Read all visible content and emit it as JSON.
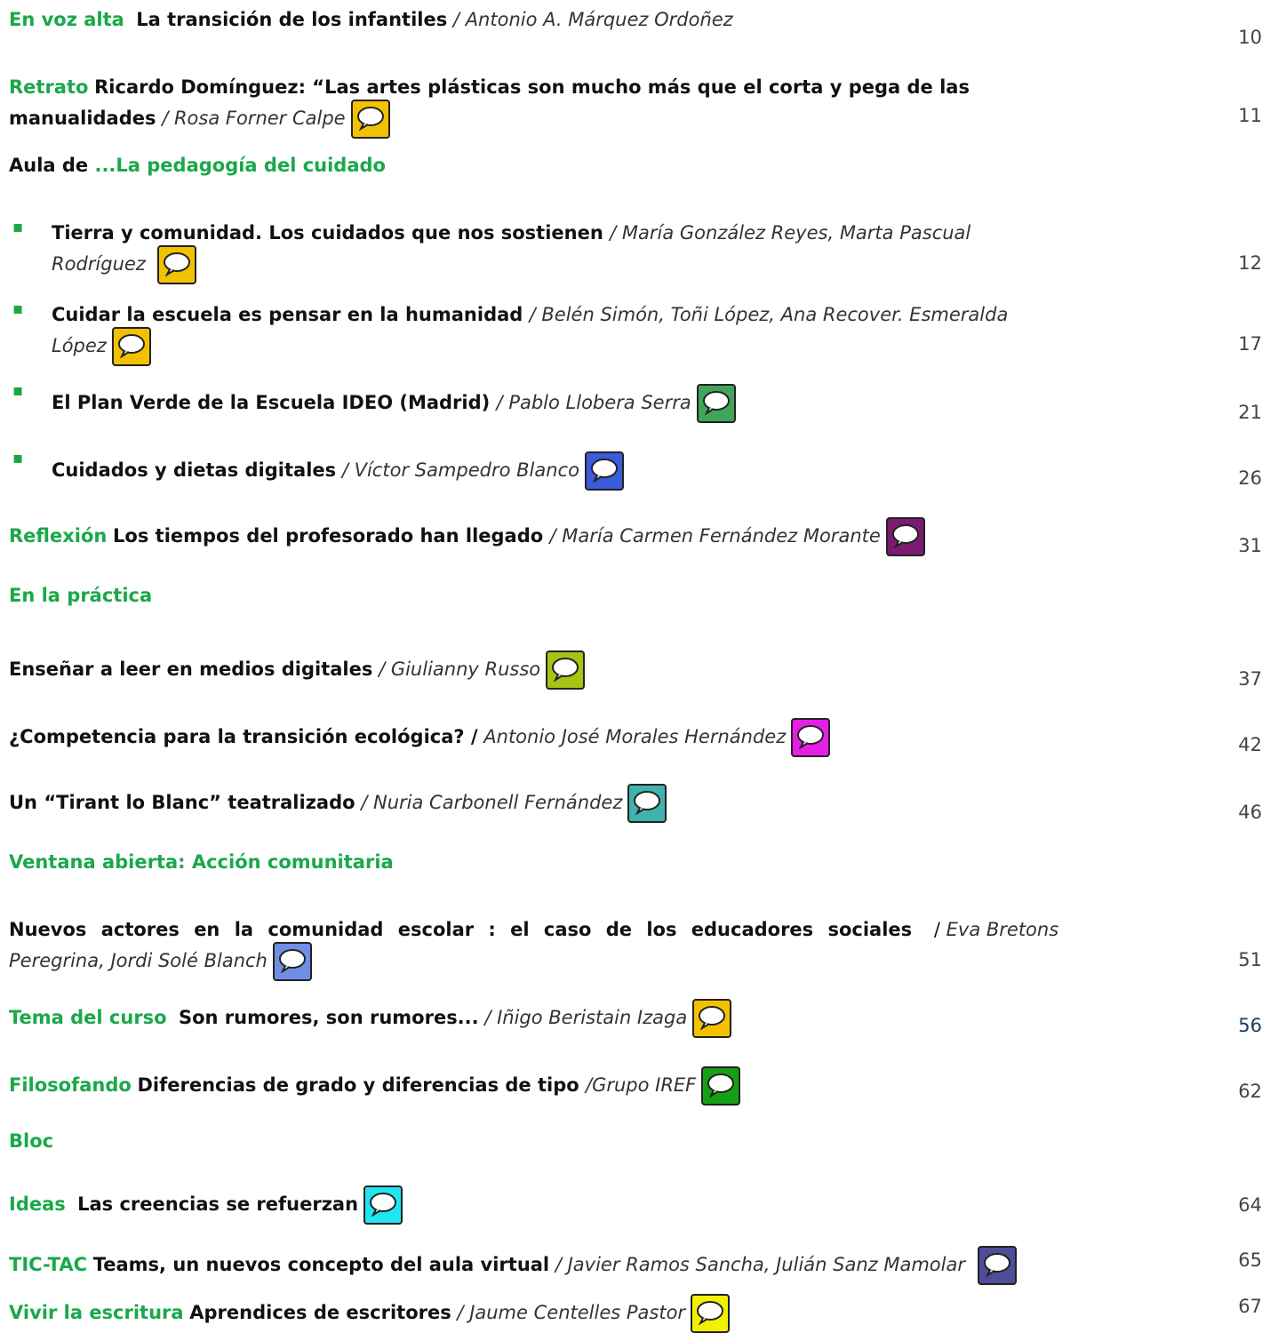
{
  "entries": [
    {
      "id": "e1",
      "section": "En voz alta",
      "title": "La transición de los infantiles",
      "author": "Antonio A. Márquez Ordoñez",
      "page": "10"
    },
    {
      "id": "e2",
      "section": "Retrato",
      "title_line1": "Ricardo Domínguez: “Las artes plásticas son mucho más  que el corta y pega de las",
      "title_line2": "manualidades",
      "author": "Rosa Forner Calpe",
      "page": "11",
      "icon": "#f2c200"
    },
    {
      "id": "e3",
      "section_a": "Aula de ",
      "section_b": "...La pedagogía del cuidado"
    },
    {
      "id": "e4",
      "title": "Tierra y comunidad. Los cuidados que nos sostienen ",
      "author_l1": "María González Reyes, Marta Pascual",
      "author_l2": "Rodríguez ",
      "page": "12",
      "icon": "#f2c200"
    },
    {
      "id": "e5",
      "title": "Cuidar la escuela es pensar en la humanidad ",
      "author_l1": "Belén Simón, Toñi López, Ana Recover. Esmeralda",
      "author_l2": "López",
      "page": "17",
      "icon": "#f2c200"
    },
    {
      "id": "e6",
      "title": "El Plan Verde de la Escuela IDEO (Madrid) ",
      "author": "Pablo Llobera Serra",
      "page": "21",
      "icon": "#3fa55a"
    },
    {
      "id": "e7",
      "title": "Cuidados y dietas digitales",
      "author": "Víctor Sampedro Blanco",
      "page": "26",
      "icon": "#3b5bdb"
    },
    {
      "id": "e8",
      "section": "Reflexión",
      "title": "Los tiempos del profesorado han llegado ",
      "author": "María Carmen Fernández Morante",
      "page": "31",
      "icon": "#7b1a6e"
    },
    {
      "id": "e9",
      "section": "En la práctica"
    },
    {
      "id": "e10",
      "title": "Enseñar a leer en medios digitales",
      "author": "Giulianny Russo",
      "page": "37",
      "icon": "#a7c412"
    },
    {
      "id": "e11",
      "title": "¿Competencia para la transición ecológica? /",
      "author": "Antonio José Morales Hernández",
      "page": "42",
      "icon": "#e61fe6"
    },
    {
      "id": "e12",
      "title": "Un “Tirant lo Blanc” teatralizado",
      "author": "Nuria Carbonell Fernández",
      "page": "46",
      "icon": "#3fb3ae"
    },
    {
      "id": "e13",
      "section": "Ventana abierta: Acción comunitaria"
    },
    {
      "id": "e14",
      "title": "Nuevos actores en la comunidad escolar : el caso de los educadores sociales",
      "author_l1": "Eva Bretons",
      "author_l2": "Peregrina, Jordi Solé Blanch",
      "page": "51",
      "icon": "#6f8fe6"
    },
    {
      "id": "e15",
      "section": "Tema del curso",
      "title": "Son rumores, son rumores...",
      "author": "Iñigo Beristain Izaga",
      "page": "56",
      "icon": "#f2c200"
    },
    {
      "id": "e16",
      "section": "Filosofando",
      "title": "Diferencias de grado y diferencias de tipo ",
      "author": "Grupo IREF",
      "page": "62",
      "icon": "#14a114"
    },
    {
      "id": "e17",
      "section": "Bloc"
    },
    {
      "id": "e18",
      "section": "Ideas",
      "title": "Las creencias se refuerzan",
      "page": "64",
      "icon": "#1ee6f2"
    },
    {
      "id": "e19",
      "section": "TIC-TAC",
      "title": "Teams, un nuevos concepto del aula virtual",
      "author": "Javier Ramos Sancha, Julián Sanz Mamolar",
      "page": "65",
      "icon": "#4d4d99"
    },
    {
      "id": "e20",
      "section": "Vivir la escritura",
      "title": "Aprendices de escritores",
      "author": "Jaume Centelles Pastor",
      "page": "67",
      "icon": "#f2f200"
    }
  ],
  "bullet_char": "▪",
  "slash": "/ "
}
